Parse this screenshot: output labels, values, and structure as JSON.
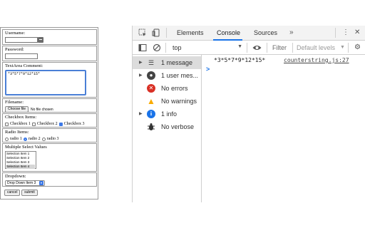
{
  "form": {
    "username_label": "Username:",
    "password_label": "Password:",
    "textarea_label": "TextArea Comment:",
    "textarea_value": "*3*5*7*9*12*15*",
    "filename_label": "Filename:",
    "choose_file_button": "Choose file",
    "no_file_text": "No file chosen",
    "checkbox_label": "Checkbox Items:",
    "checkboxes": [
      {
        "label": "Checkbox 1",
        "checked": false
      },
      {
        "label": "Checkbox 2",
        "checked": false
      },
      {
        "label": "Checkbox 3",
        "checked": true
      }
    ],
    "radio_label": "Radio Items:",
    "radios": [
      {
        "label": "radio 1",
        "checked": false
      },
      {
        "label": "radio 2",
        "checked": true
      },
      {
        "label": "radio 3",
        "checked": false
      }
    ],
    "multiselect_label": "Multiple Select Values",
    "multiselect_items": [
      "Selection Item 1",
      "Selection Item 2",
      "Selection Item 3",
      "Selection Item 4"
    ],
    "multiselect_selected": "Selection Item 4",
    "dropdown_label": "Dropdown:",
    "dropdown_value": "Drop Down Item 3",
    "cancel_button": "cancel",
    "submit_button": "submit"
  },
  "devtools": {
    "tabs": [
      "Elements",
      "Console",
      "Sources"
    ],
    "active_tab": "Console",
    "more_tabs_icon": "chevron-double-right-icon",
    "context_select": "top",
    "filter_placeholder": "Filter",
    "levels_select": "Default levels",
    "sidebar": [
      {
        "label": "1 message",
        "icon": "list-icon",
        "expandable": true,
        "selected": true
      },
      {
        "label": "1 user mes...",
        "icon": "user-icon",
        "expandable": true,
        "selected": false
      },
      {
        "label": "No errors",
        "icon": "error-icon",
        "expandable": false,
        "selected": false
      },
      {
        "label": "No warnings",
        "icon": "warning-icon",
        "expandable": false,
        "selected": false
      },
      {
        "label": "1 info",
        "icon": "info-icon",
        "expandable": true,
        "selected": false
      },
      {
        "label": "No verbose",
        "icon": "bug-icon",
        "expandable": false,
        "selected": false
      }
    ],
    "console_message": "*3*5*7*9*12*15*",
    "console_source": "counterstring.js:27",
    "prompt_symbol": ">",
    "colors": {
      "accent": "#1a73e8",
      "error": "#d93025",
      "warning": "#f9ab00",
      "info": "#1a73e8"
    }
  }
}
